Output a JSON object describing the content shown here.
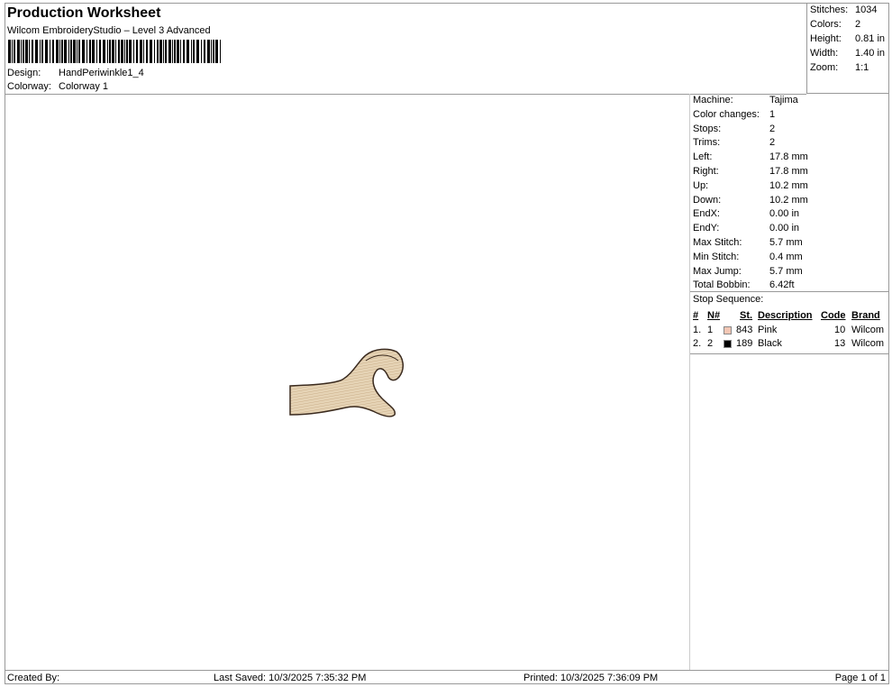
{
  "header": {
    "title": "Production Worksheet",
    "subtitle": "Wilcom EmbroideryStudio – Level 3 Advanced",
    "design_label": "Design:",
    "design": "HandPeriwinkle1_4",
    "colorway_label": "Colorway:",
    "colorway": "Colorway 1"
  },
  "stats": [
    {
      "k": "Stitches:",
      "v": "1034"
    },
    {
      "k": "Colors:",
      "v": "2"
    },
    {
      "k": "Height:",
      "v": "0.81 in"
    },
    {
      "k": "Width:",
      "v": "1.40 in"
    },
    {
      "k": "Zoom:",
      "v": "1:1"
    }
  ],
  "details": [
    {
      "k": "Machine:",
      "v": "Tajima"
    },
    {
      "k": "Color changes:",
      "v": "1"
    },
    {
      "k": "Stops:",
      "v": "2"
    },
    {
      "k": "Trims:",
      "v": "2"
    },
    {
      "k": "Left:",
      "v": "17.8 mm"
    },
    {
      "k": "Right:",
      "v": "17.8 mm"
    },
    {
      "k": "Up:",
      "v": "10.2 mm"
    },
    {
      "k": "Down:",
      "v": "10.2 mm"
    },
    {
      "k": "EndX:",
      "v": "0.00 in"
    },
    {
      "k": "EndY:",
      "v": "0.00 in"
    },
    {
      "k": "Max Stitch:",
      "v": "5.7 mm"
    },
    {
      "k": "Min Stitch:",
      "v": "0.4 mm"
    },
    {
      "k": "Max Jump:",
      "v": "5.7 mm"
    },
    {
      "k": "Total Bobbin:",
      "v": "6.42ft"
    }
  ],
  "stop_sequence": {
    "title": "Stop Sequence:",
    "headers": [
      "#",
      "N#",
      "St.",
      "Description",
      "Code",
      "Brand"
    ],
    "rows": [
      {
        "num": "1.",
        "n": "1",
        "color": "#f2c6b4",
        "st": "843",
        "desc": "Pink",
        "code": "10",
        "brand": "Wilcom"
      },
      {
        "num": "2.",
        "n": "2",
        "color": "#000000",
        "st": "189",
        "desc": "Black",
        "code": "13",
        "brand": "Wilcom"
      }
    ]
  },
  "footer": {
    "created": "Created By:",
    "saved": "Last Saved: 10/3/2025 7:35:32 PM",
    "printed": "Printed: 10/3/2025 7:36:09 PM",
    "page": "Page 1 of 1"
  },
  "colors": {
    "fill": "#e2cfb0",
    "outline": "#3a2a1e"
  }
}
